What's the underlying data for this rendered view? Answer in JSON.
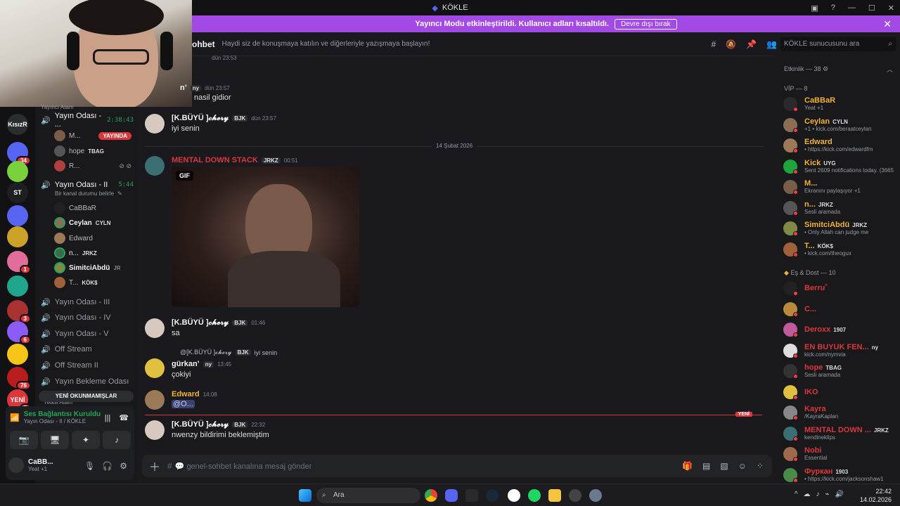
{
  "window": {
    "title": "KÖKLE"
  },
  "banner": {
    "text": "Yayıncı Modu etkinleştirildi. Kullanıcı adları kısaltıldı.",
    "button": "Devre dışı bırak",
    "close": "✕"
  },
  "servers": [
    {
      "label": "KısızR",
      "color": "#2b2d31"
    },
    {
      "label": "",
      "color": "#5865f2",
      "badge": "34"
    },
    {
      "label": "",
      "color": "#7bd13b"
    },
    {
      "label": "ST",
      "color": "#1e1f22"
    },
    {
      "label": "",
      "color": "#5865f2"
    },
    {
      "label": "",
      "color": "#c9a227"
    },
    {
      "label": "",
      "color": "#e06d9a",
      "badge": "1"
    },
    {
      "label": "",
      "color": "#1fa68d"
    },
    {
      "label": "",
      "color": "#a83232",
      "badge": "3"
    },
    {
      "label": "",
      "color": "#8b5cf6",
      "badge": "6"
    },
    {
      "label": "",
      "color": "#f5c518"
    },
    {
      "label": "",
      "color": "#b91c1c",
      "badge": "76"
    },
    {
      "label": "YENİ",
      "color": "#da373c",
      "badge": "5"
    }
  ],
  "sidebar": {
    "category_partial": "Yayıncı Atam",
    "voice_channels": [
      {
        "label": "Yayın Odası - ...",
        "timer": "2:38:43"
      },
      {
        "label": "Yayın Odası - II",
        "timer": "5:44",
        "status": "Bir kanal durumu belirle"
      },
      {
        "label": "Yayın Odası - III"
      },
      {
        "label": "Yayın Odası - IV"
      },
      {
        "label": "Yayın Odası - V"
      },
      {
        "label": "Off Stream"
      },
      {
        "label": "Off Stream II"
      },
      {
        "label": "Yayın Bekleme Odası"
      }
    ],
    "room1_users": [
      {
        "name": "M...",
        "live": "YAYINDA"
      },
      {
        "name": "hope",
        "tag": "TBAG"
      },
      {
        "name": "R..."
      }
    ],
    "room2_users": [
      {
        "name": "CaBBaR"
      },
      {
        "name": "Ceylan",
        "tag": "CYLN"
      },
      {
        "name": "Edward"
      },
      {
        "name": "n...",
        "tag": "JRKZ"
      },
      {
        "name": "SimitciAbdü",
        "tag": "JR"
      },
      {
        "name": "T...",
        "tag": "KÖK$"
      }
    ],
    "unread_label": "YENİ OKUNMAMIŞLAR",
    "unread_under": "Yetkili Atam"
  },
  "voice_panel": {
    "status": "Ses Bağlantısı Kuruldu",
    "channel": "Yayın Odası - II / KÖKLE",
    "user_name": "CaBB...",
    "user_status": "Yeat +1"
  },
  "chat": {
    "channel_name": "ohbet",
    "topic": "Haydi siz de konuşmaya katılın ve diğerleriyle yazışmaya başlayın!",
    "search_placeholder": "KÖKLE sunucusunu ara",
    "date_divider": "14 Şubat 2026",
    "new_label": "YENİ",
    "composer_placeholder": "💬 genel-sohbet kanalına mesaj gönder"
  },
  "messages": [
    {
      "time_top": "dün 23:53"
    },
    {
      "name": "n’",
      "tag": "ny",
      "time": "dün 23:57",
      "text": "nasil gidior"
    },
    {
      "name": "[K.BÜYÜ ]𝓬𝓱𝓮𝓻𝔂",
      "tag": "BJK",
      "time": "dün 23:57",
      "text": "iyi senin"
    },
    {
      "name": "MENTAL DOWN STACK",
      "tag": "JRKZ",
      "time": "00:51",
      "gif": "GIF"
    },
    {
      "name": "[K.BÜYÜ ]𝓬𝓱𝓮𝓻𝔂",
      "tag": "BJK",
      "time": "01:46",
      "text": "sa"
    },
    {
      "reply_name": "@[K.BÜYÜ ]𝓬𝓱𝓮𝓻𝔂",
      "reply_tag": "BJK",
      "reply_text": "iyi senin",
      "name": "gürkan’",
      "tag": "ny",
      "time": "13:45",
      "text": "çokiyi"
    },
    {
      "name": "Edward",
      "time": "14:08",
      "text": "@O..."
    },
    {
      "name": "[K.BÜYÜ ]𝓬𝓱𝓮𝓻𝔂",
      "tag": "BJK",
      "time": "22:32",
      "text": "nwenzy bildirimi beklemiştim"
    }
  ],
  "members": {
    "activity_header": "Etkinlik — 38",
    "vip_header": "VİP — 8",
    "friends_header": "Eş & Dost — 10",
    "vip": [
      {
        "name": "CaBBaR",
        "status": "Yeat +1",
        "color": "#f0b232"
      },
      {
        "name": "Ceylan",
        "tag": "CYLN",
        "status": "+1 • kick.com/beraatceylan",
        "color": "#f0b232"
      },
      {
        "name": "Edward",
        "status": "• https://kick.com/edwardfm",
        "color": "#f0b232"
      },
      {
        "name": "Kick",
        "tag": "UYG",
        "status": "Sent 2609 notifications today. (3665",
        "color": "#f0b232"
      },
      {
        "name": "M...",
        "status": "Ekranını paylaşıyor +1",
        "color": "#f0b232"
      },
      {
        "name": "n...",
        "tag": "JRKZ",
        "status": "Sesli aramada",
        "color": "#f0b232"
      },
      {
        "name": "SimitciAbdü",
        "tag": "JRKZ",
        "status": "• Only Allah can judge me",
        "color": "#f0b232"
      },
      {
        "name": "T...",
        "tag": "KÖK$",
        "status": "• kick.com/theogux",
        "color": "#f0b232"
      }
    ],
    "friends": [
      {
        "name": "Berru˚",
        "status": "",
        "color": "#da373c"
      },
      {
        "name": "C...",
        "status": "",
        "color": "#da373c"
      },
      {
        "name": "Deroxx",
        "tag": "1907",
        "status": "",
        "color": "#da373c"
      },
      {
        "name": "EN BUYUK FEN...",
        "tag": "ny",
        "status": "kick.com/nymvia",
        "color": "#da373c"
      },
      {
        "name": "hope",
        "tag": "TBAG",
        "status": "Sesli aramada",
        "color": "#da373c"
      },
      {
        "name": "IKO",
        "status": "",
        "color": "#da373c"
      },
      {
        "name": "Kayra",
        "status": "/KayraKaplan",
        "color": "#da373c"
      },
      {
        "name": "MENTAL DOWN ...",
        "tag": "JRKZ",
        "status": "kendineklips",
        "color": "#da373c"
      },
      {
        "name": "Nobi",
        "status": "Essential",
        "color": "#da373c"
      },
      {
        "name": "Фуркан",
        "tag": "1903",
        "status": "• https://kick.com/jacksonshaw1",
        "color": "#da373c"
      }
    ]
  },
  "taskbar": {
    "search": "Ara",
    "time": "22:42",
    "date": "14.02.2026"
  }
}
